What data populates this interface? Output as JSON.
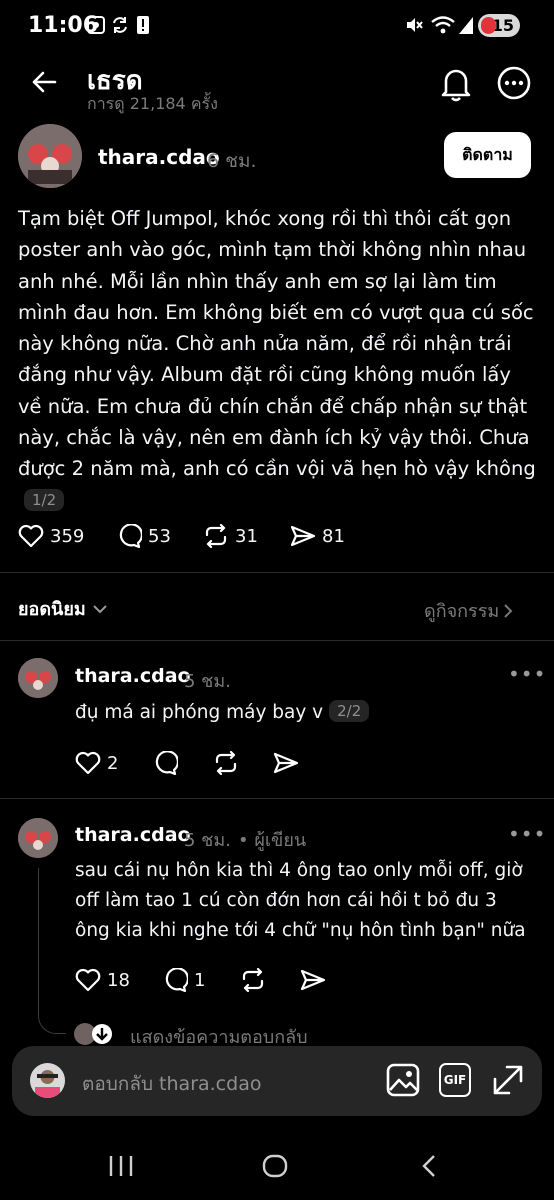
{
  "status_bar": {
    "time": "11:06",
    "battery": "15"
  },
  "header": {
    "title": "เธรด",
    "subtitle": "การดู 21,184 ครั้ง"
  },
  "post": {
    "username": "thara.cdao",
    "time": "6 ชม.",
    "follow_label": "ติดตาม",
    "text": "Tạm biệt Off Jumpol, khóc xong rồi thì thôi cất gọn poster anh vào góc, mình tạm thời không nhìn nhau anh nhé. Mỗi lần nhìn thấy anh em sợ lại làm tim mình đau hơn. Em không biết em có vượt qua cú sốc này không nữa. Chờ anh nửa năm, để rồi nhận trái đắng như vậy. Album đặt rồi cũng không muốn lấy về nữa. Em chưa đủ chín chắn để chấp nhận sự thật này, chắc là vậy, nên em đành ích kỷ vậy thôi. Chưa được 2 năm mà, anh có cần vội vã hẹn hò vậy không",
    "page": "1/2",
    "likes": "359",
    "comments": "53",
    "reposts": "31",
    "shares": "81"
  },
  "sort": {
    "label": "ยอดนิยม",
    "activity": "ดูกิจกรรม"
  },
  "replies": [
    {
      "username": "thara.cdao",
      "time": "5 ชม.",
      "text": "đụ má ai phóng máy bay v",
      "page": "2/2",
      "likes": "2"
    },
    {
      "username": "thara.cdao",
      "time": "5 ชม.",
      "author_tag": "• ผู้เขียน",
      "text": "sau cái nụ hôn kia thì 4 ông tao only mỗi off, giờ off làm tao 1 cú còn đớn hơn cái hồi t bỏ đu 3 ông kia khi nghe tới 4 chữ \"nụ hôn tình bạn\" nữa",
      "likes": "18",
      "comments": "1",
      "show_replies": "แสดงข้อความตอบกลับ"
    }
  ],
  "composer": {
    "placeholder": "ตอบกลับ thara.cdao",
    "gif_label": "GIF"
  },
  "colors": {
    "background": "#000000",
    "text": "#f3f5f7",
    "muted": "#7a7a7a",
    "battery_accent": "#e0343a"
  }
}
